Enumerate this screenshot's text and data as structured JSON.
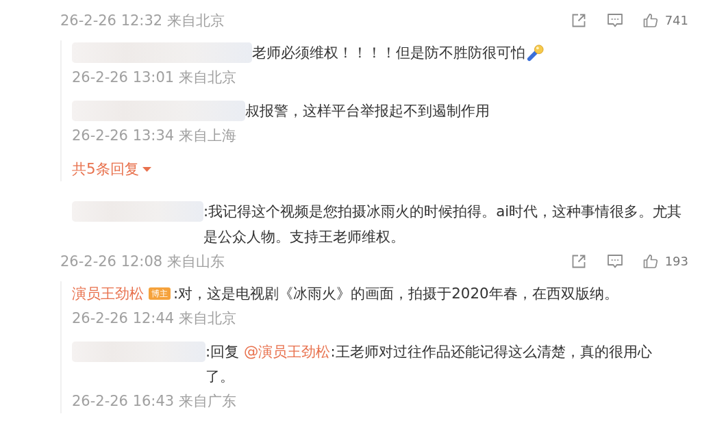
{
  "comments": [
    {
      "time": "26-2-26 12:32 来自北京",
      "actions": {
        "likes": "741"
      },
      "replies": [
        {
          "author": {
            "kind": "hidden"
          },
          "segments": [
            {
              "kind": "text",
              "text": "老师必须维权！！！！但是防不胜防很可怕"
            },
            {
              "kind": "emoji"
            }
          ],
          "time": "26-2-26 13:01 来自北京"
        },
        {
          "author": {
            "kind": "hidden"
          },
          "segments": [
            {
              "kind": "text",
              "text": "叔报警，这样平台举报起不到遏制作用"
            }
          ],
          "time": "26-2-26 13:34 来自上海"
        }
      ],
      "more_replies": "共5条回复"
    },
    {
      "author": {
        "kind": "hidden"
      },
      "segments": [
        {
          "kind": "text",
          "text": ":我记得这个视频是您拍摄冰雨火的时候拍得。ai时代，这种事情很多。尤其是公众人物。支持王老师维权。"
        }
      ],
      "time": "26-2-26 12:08 来自山东",
      "actions": {
        "likes": "193"
      },
      "replies": [
        {
          "author": {
            "kind": "named",
            "name": "演员王劲松",
            "tag": "博主"
          },
          "segments": [
            {
              "kind": "text",
              "text": ":对，这是电视剧《冰雨火》的画面，拍摄于2020年春，在西双版纳。"
            }
          ],
          "time": "26-2-26 12:44 来自北京"
        },
        {
          "author": {
            "kind": "hidden"
          },
          "segments": [
            {
              "kind": "text",
              "text": ":回复 "
            },
            {
              "kind": "mention",
              "text": "@演员王劲松"
            },
            {
              "kind": "text",
              "text": ":王老师对过往作品还能记得这么清楚，真的很用心了。"
            }
          ],
          "time": "26-2-26 16:43 来自广东"
        }
      ]
    }
  ]
}
